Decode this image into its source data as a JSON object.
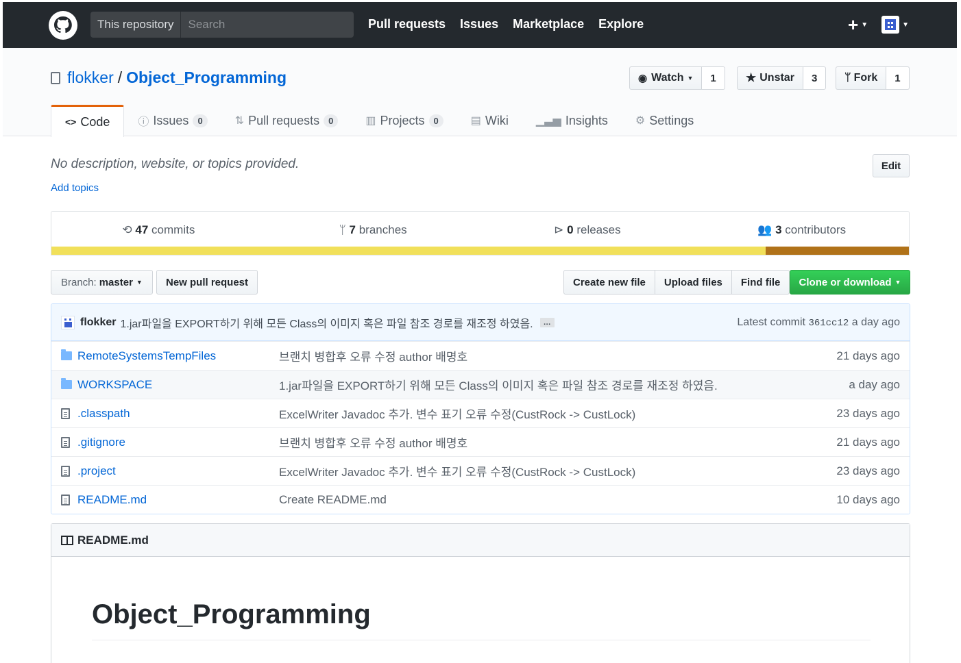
{
  "header": {
    "search_scope": "This repository",
    "search_placeholder": "Search",
    "nav": [
      "Pull requests",
      "Issues",
      "Marketplace",
      "Explore"
    ],
    "plus": "+"
  },
  "repo": {
    "owner": "flokker",
    "separator": "/",
    "name": "Object_Programming",
    "watch_label": "Watch",
    "watch_count": "1",
    "star_label": "Unstar",
    "star_count": "3",
    "fork_label": "Fork",
    "fork_count": "1"
  },
  "tabs": {
    "code": "Code",
    "issues": "Issues",
    "issues_count": "0",
    "pulls": "Pull requests",
    "pulls_count": "0",
    "projects": "Projects",
    "projects_count": "0",
    "wiki": "Wiki",
    "insights": "Insights",
    "settings": "Settings"
  },
  "description": {
    "text": "No description, website, or topics provided.",
    "add_topics": "Add topics",
    "edit": "Edit"
  },
  "summary": {
    "commits_num": "47",
    "commits_label": "commits",
    "branches_num": "7",
    "branches_label": "branches",
    "releases_num": "0",
    "releases_label": "releases",
    "contributors_num": "3",
    "contributors_label": "contributors",
    "lang_colors": [
      "#f1e05a",
      "#b07219"
    ]
  },
  "filenav": {
    "branch_prefix": "Branch:",
    "branch": "master",
    "new_pr": "New pull request",
    "create_file": "Create new file",
    "upload": "Upload files",
    "find": "Find file",
    "clone": "Clone or download"
  },
  "commit": {
    "author": "flokker",
    "message": "1.jar파일을 EXPORT하기 위해 모든 Class의 이미지 혹은 파일 참조 경로를 재조정 하였음.",
    "ellipsis": "…",
    "latest_prefix": "Latest commit",
    "sha": "361cc12",
    "age": "a day ago"
  },
  "files": [
    {
      "type": "folder",
      "name": "RemoteSystemsTempFiles",
      "message": "브랜치 병합후 오류 수정 author 배명호",
      "age": "21 days ago"
    },
    {
      "type": "folder",
      "name": "WORKSPACE",
      "message": "1.jar파일을 EXPORT하기 위해 모든 Class의 이미지 혹은 파일 참조 경로를 재조정 하였음.",
      "age": "a day ago"
    },
    {
      "type": "file",
      "name": ".classpath",
      "message": "ExcelWriter Javadoc 추가. 변수 표기 오류 수정(CustRock -> CustLock)",
      "age": "23 days ago"
    },
    {
      "type": "file",
      "name": ".gitignore",
      "message": "브랜치 병합후 오류 수정 author 배명호",
      "age": "21 days ago"
    },
    {
      "type": "file",
      "name": ".project",
      "message": "ExcelWriter Javadoc 추가. 변수 표기 오류 수정(CustRock -> CustLock)",
      "age": "23 days ago"
    },
    {
      "type": "file",
      "name": "README.md",
      "message": "Create README.md",
      "age": "10 days ago"
    }
  ],
  "readme": {
    "filename": "README.md",
    "title": "Object_Programming"
  }
}
